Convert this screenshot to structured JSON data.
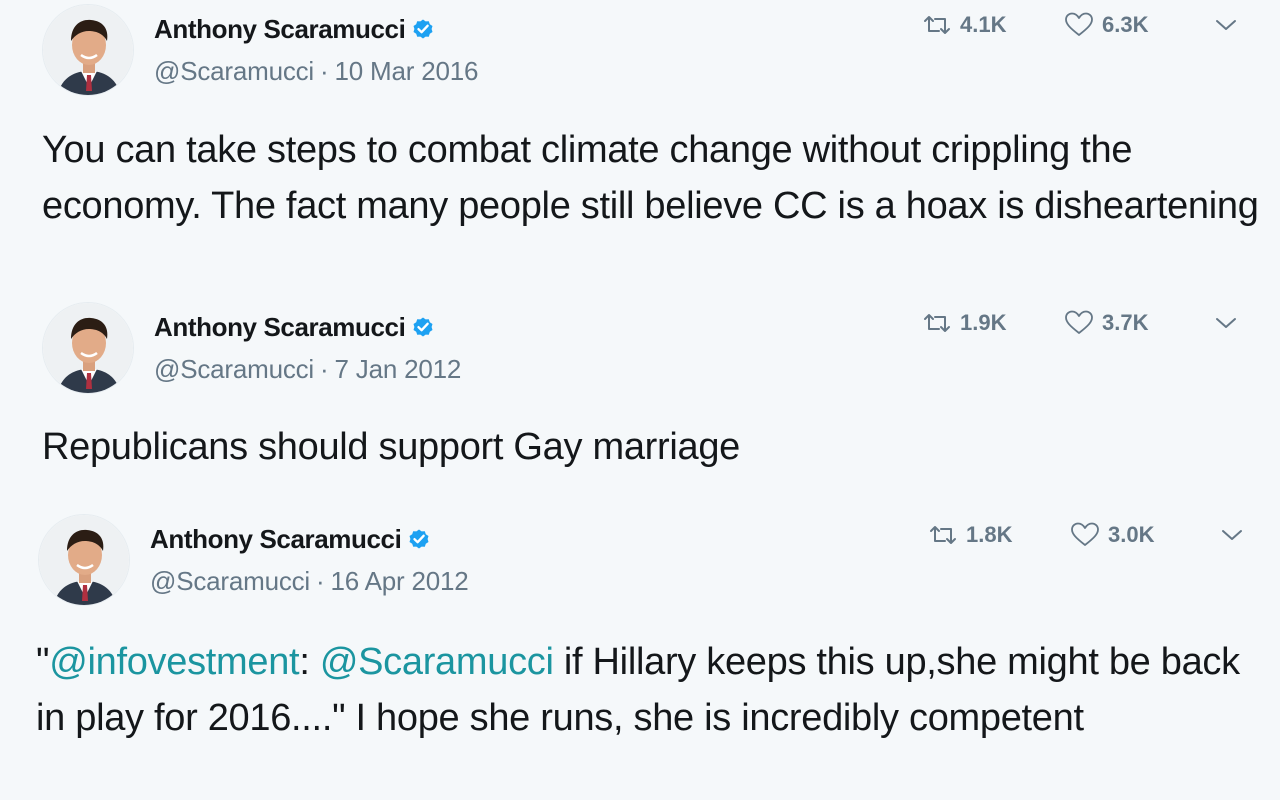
{
  "tweets": [
    {
      "author_name": "Anthony Scaramucci",
      "handle": "@Scaramucci",
      "separator": "·",
      "date": "10 Mar 2016",
      "retweets": "4.1K",
      "likes": "6.3K",
      "text_segments": [
        {
          "text": "You can take steps to combat climate change without crippling the economy. The fact many people still believe CC is a hoax is disheartening",
          "type": "plain"
        }
      ]
    },
    {
      "author_name": "Anthony Scaramucci",
      "handle": "@Scaramucci",
      "separator": "·",
      "date": "7 Jan 2012",
      "retweets": "1.9K",
      "likes": "3.7K",
      "text_segments": [
        {
          "text": "Republicans should support Gay marriage",
          "type": "plain"
        }
      ]
    },
    {
      "author_name": "Anthony Scaramucci",
      "handle": "@Scaramucci",
      "separator": "·",
      "date": "16 Apr 2012",
      "retweets": "1.8K",
      "likes": "3.0K",
      "text_segments": [
        {
          "text": "\"",
          "type": "plain"
        },
        {
          "text": "@infovestment",
          "type": "mention"
        },
        {
          "text": ": ",
          "type": "plain"
        },
        {
          "text": "@Scaramucci",
          "type": "mention"
        },
        {
          "text": " if Hillary keeps this up,she might be back in play for 2016....\" I hope she runs, she is incredibly competent",
          "type": "plain"
        }
      ]
    }
  ],
  "icons": {
    "verified": "verified-badge-icon",
    "retweet": "retweet-icon",
    "like": "heart-icon",
    "caret": "chevron-down-icon",
    "avatar": "avatar"
  },
  "colors": {
    "background": "#f5f8fa",
    "text": "#14171a",
    "muted": "#657786",
    "verified": "#1da1f2",
    "mention": "#1b95a0"
  }
}
